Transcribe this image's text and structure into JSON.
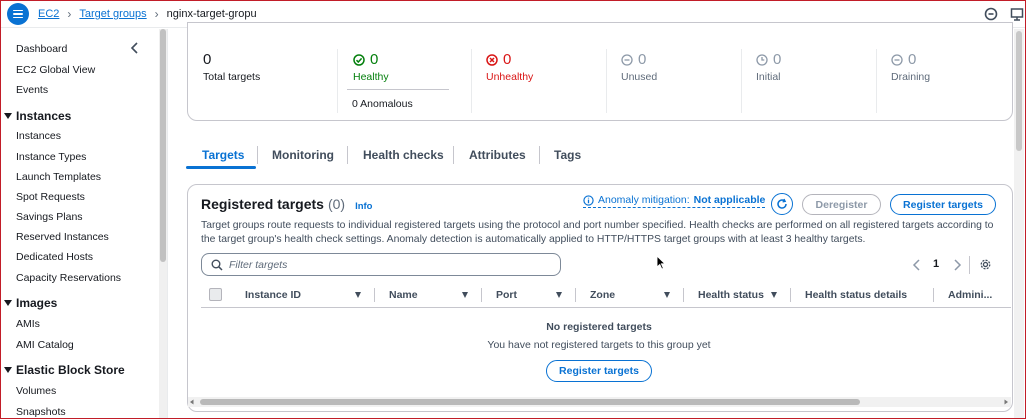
{
  "breadcrumbs": [
    "EC2",
    "Target groups",
    "nginx-target-gropu"
  ],
  "sidebar": {
    "items_top": [
      "Dashboard",
      "EC2 Global View",
      "Events"
    ],
    "sections": [
      {
        "title": "Instances",
        "items": [
          "Instances",
          "Instance Types",
          "Launch Templates",
          "Spot Requests",
          "Savings Plans",
          "Reserved Instances",
          "Dedicated Hosts",
          "Capacity Reservations"
        ]
      },
      {
        "title": "Images",
        "items": [
          "AMIs",
          "AMI Catalog"
        ]
      },
      {
        "title": "Elastic Block Store",
        "items": [
          "Volumes",
          "Snapshots"
        ]
      }
    ]
  },
  "metrics": {
    "total": {
      "value": "0",
      "label": "Total targets"
    },
    "healthy": {
      "value": "0",
      "label": "Healthy"
    },
    "anomalous": {
      "label": "0 Anomalous"
    },
    "unhealthy": {
      "value": "0",
      "label": "Unhealthy"
    },
    "unused": {
      "value": "0",
      "label": "Unused"
    },
    "initial": {
      "value": "0",
      "label": "Initial"
    },
    "draining": {
      "value": "0",
      "label": "Draining"
    }
  },
  "tabs": [
    "Targets",
    "Monitoring",
    "Health checks",
    "Attributes",
    "Tags"
  ],
  "registered": {
    "title": "Registered targets",
    "count": "(0)",
    "info": "Info",
    "anomaly_label": "Anomaly mitigation:",
    "anomaly_value": "Not applicable",
    "deregister": "Deregister",
    "register": "Register targets",
    "description": "Target groups route requests to individual registered targets using the protocol and port number specified. Health checks are performed on all registered targets according to the target group's health check settings. Anomaly detection is automatically applied to HTTP/HTTPS target groups with at least 3 healthy targets.",
    "filter_placeholder": "Filter targets",
    "page": "1",
    "columns": [
      "Instance ID",
      "Name",
      "Port",
      "Zone",
      "Health status",
      "Health status details",
      "Admini..."
    ],
    "empty_title": "No registered targets",
    "empty_desc": "You have not registered targets to this group yet",
    "empty_button": "Register targets"
  },
  "colors": {
    "accent": "#0972d3",
    "success": "#037f0c",
    "error": "#d91515",
    "muted": "#8d99a8"
  }
}
